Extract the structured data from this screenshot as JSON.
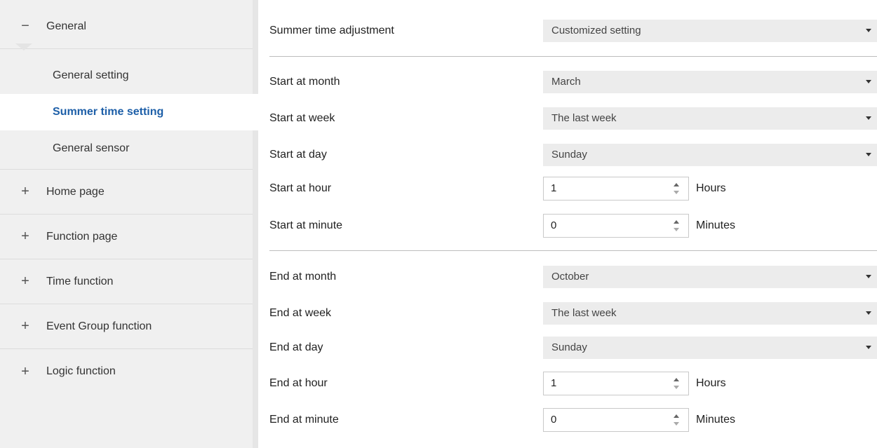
{
  "sidebar": {
    "general": {
      "sign": "−",
      "label": "General"
    },
    "sub_items": [
      {
        "label": "General setting"
      },
      {
        "label": "Summer time setting"
      },
      {
        "label": "General sensor"
      }
    ],
    "items": [
      {
        "sign": "+",
        "label": "Home page"
      },
      {
        "sign": "+",
        "label": "Function page"
      },
      {
        "sign": "+",
        "label": "Time function"
      },
      {
        "sign": "+",
        "label": "Event Group function"
      },
      {
        "sign": "+",
        "label": "Logic function"
      }
    ]
  },
  "main": {
    "summer_adjustment": {
      "label": "Summer time adjustment",
      "value": "Customized setting"
    },
    "start": {
      "month": {
        "label": "Start at month",
        "value": "March"
      },
      "week": {
        "label": "Start at week",
        "value": "The last week"
      },
      "day": {
        "label": "Start at day",
        "value": "Sunday"
      },
      "hour": {
        "label": "Start at hour",
        "value": "1",
        "unit": "Hours"
      },
      "minute": {
        "label": "Start at minute",
        "value": "0",
        "unit": "Minutes"
      }
    },
    "end": {
      "month": {
        "label": "End at month",
        "value": "October"
      },
      "week": {
        "label": "End at week",
        "value": "The last week"
      },
      "day": {
        "label": "End at day",
        "value": "Sunday"
      },
      "hour": {
        "label": "End at hour",
        "value": "1",
        "unit": "Hours"
      },
      "minute": {
        "label": "End at minute",
        "value": "0",
        "unit": "Minutes"
      }
    }
  },
  "colors": {
    "active_text": "#1d5fa8",
    "sidebar_bg": "#f0f0f0",
    "dropdown_bg": "#ececec"
  },
  "icons": {
    "collapse": "minus-icon",
    "expand": "plus-icon",
    "dropdown": "caret-down-icon",
    "spinner": "spinner-arrows-icon"
  }
}
